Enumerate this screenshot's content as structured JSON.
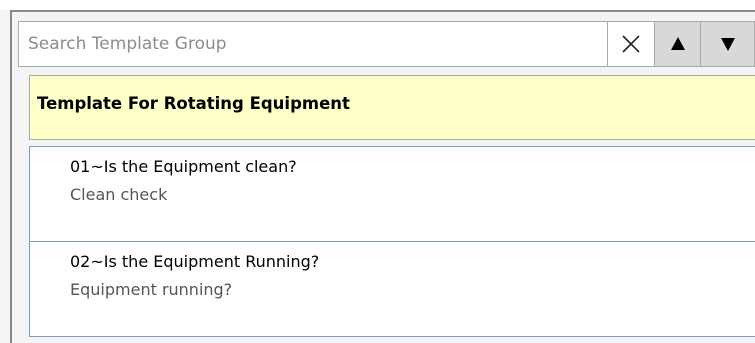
{
  "search": {
    "placeholder": "Search Template Group",
    "value": ""
  },
  "buttons": {
    "clear_icon": "close-icon",
    "up_icon": "triangle-up-icon",
    "down_icon": "triangle-down-icon"
  },
  "group": {
    "title": "Template For Rotating Equipment",
    "background": "#ffffc8"
  },
  "items": [
    {
      "title": "01~Is the Equipment clean?",
      "subtitle": "Clean check"
    },
    {
      "title": "02~Is the Equipment Running?",
      "subtitle": "Equipment running?"
    }
  ]
}
